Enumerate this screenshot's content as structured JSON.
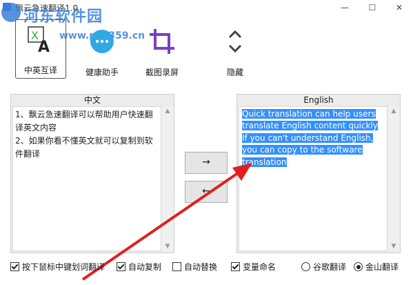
{
  "window": {
    "title": "飘云急速翻译1.0",
    "min_glyph": "—",
    "max_glyph": "☐",
    "close_glyph": "✕"
  },
  "watermark": {
    "text": "河东软件园",
    "url": "www.pc0359.cn"
  },
  "toolbar": {
    "items": [
      {
        "label": "中英互译",
        "icon": "translate-icon",
        "active": true
      },
      {
        "label": "健康助手",
        "icon": "chat-bubble-icon"
      },
      {
        "label": "截图录屏",
        "icon": "crop-icon"
      },
      {
        "label": "隐藏",
        "icon": "chevron-up-down-icon"
      }
    ]
  },
  "left_panel": {
    "header": "中文",
    "text": "1、飘云急速翻译可以帮助用户快速翻译英文内容\n2、如果你看不懂英文就可以复制到软件翻译"
  },
  "right_panel": {
    "header": "English",
    "text": "Quick translation can help users translate English content quickly If you can't understand English, you can copy to the software translation"
  },
  "buttons": {
    "forward": "→",
    "back": "←"
  },
  "options": {
    "mouse_translate": {
      "label": "按下鼠标中键划词翻译",
      "checked": true
    },
    "auto_copy": {
      "label": "自动复制",
      "checked": true
    },
    "auto_replace": {
      "label": "自动替换",
      "checked": false
    },
    "var_naming": {
      "label": "变量命名",
      "checked": true
    },
    "google": {
      "label": "谷歌翻译",
      "selected": false
    },
    "jinshan": {
      "label": "金山翻译",
      "selected": true
    }
  },
  "colors": {
    "accent": "#3b7fd9",
    "selection": "#3390ff",
    "annotation": "#e02020"
  }
}
